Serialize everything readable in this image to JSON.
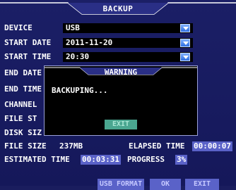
{
  "title": "BACKUP",
  "fields": [
    {
      "label": "DEVICE",
      "value": "USB",
      "dropdown": true
    },
    {
      "label": "START DATE",
      "value": "2011-11-20",
      "dropdown": true
    },
    {
      "label": "START TIME",
      "value": "20:30",
      "dropdown": true
    },
    {
      "label": "END DATE",
      "value": "",
      "dropdown": false
    },
    {
      "label": "END TIME",
      "value": "",
      "dropdown": false
    },
    {
      "label": "CHANNEL",
      "value": "",
      "dropdown": false
    },
    {
      "label": "FILE ST",
      "value": "",
      "dropdown": false
    },
    {
      "label": "DISK SIZ",
      "value": "",
      "dropdown": false
    }
  ],
  "file_size_label": "FILE SIZE",
  "file_size_value": "237MB",
  "elapsed_label": "ELAPSED TIME",
  "elapsed_value": "00:00:07",
  "estimated_label": "ESTIMATED TIME",
  "estimated_value": "00:03:31",
  "progress_label": "PROGRESS",
  "progress_value": "3%",
  "dialog": {
    "title": "WARNING",
    "message": "BACKUPING...",
    "button": "EXIT"
  },
  "footer": {
    "usb_format": "USB FORMAT",
    "ok": "OK",
    "exit": "EXIT"
  },
  "colors": {
    "background": "#1a1d5e",
    "highlight": "#5a62c8",
    "dialog_button": "#4aa690"
  }
}
